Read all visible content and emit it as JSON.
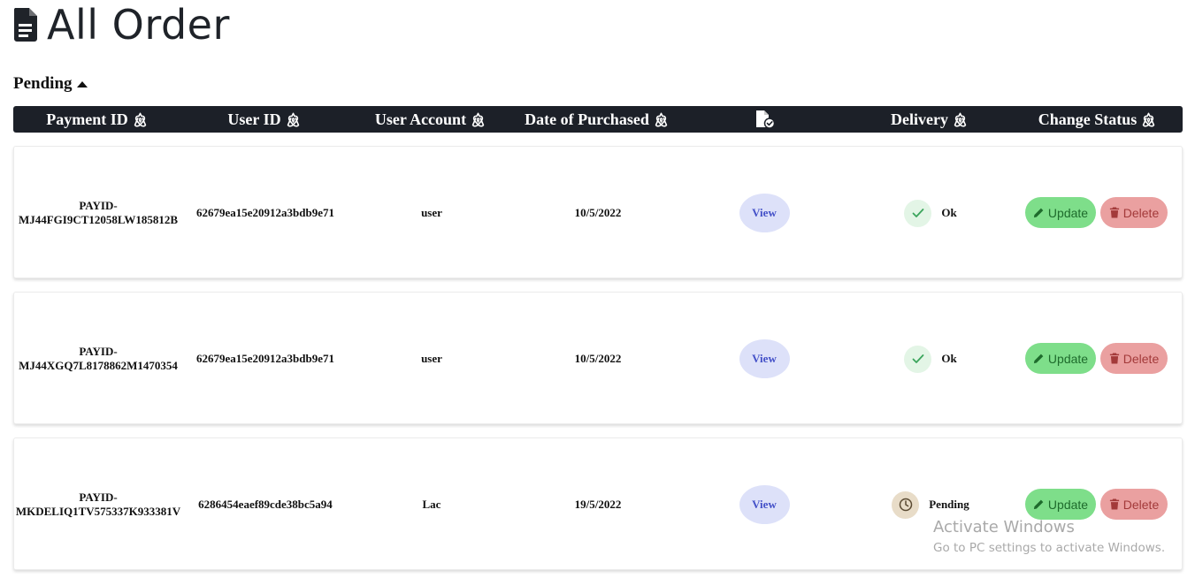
{
  "page": {
    "title": "All Order"
  },
  "section": {
    "label": "Pending"
  },
  "table": {
    "headers": {
      "payment_id": "Payment ID",
      "user_id": "User ID",
      "user_account": "User Account",
      "date": "Date of Purchased",
      "delivery": "Delivery",
      "change_status": "Change Status"
    }
  },
  "orders": [
    {
      "payment_line1": "PAYID-",
      "payment_line2": "MJ44FGI9CT12058LW185812B",
      "user_id": "62679ea15e20912a3bdb9e71",
      "account": "user",
      "date": "10/5/2022",
      "view_label": "View",
      "delivery": "Ok",
      "update_label": "Update",
      "delete_label": "Delete"
    },
    {
      "payment_line1": "PAYID-",
      "payment_line2": "MJ44XGQ7L8178862M1470354",
      "user_id": "62679ea15e20912a3bdb9e71",
      "account": "user",
      "date": "10/5/2022",
      "view_label": "View",
      "delivery": "Ok",
      "update_label": "Update",
      "delete_label": "Delete"
    },
    {
      "payment_line1": "PAYID-",
      "payment_line2": "MKDELIQ1TV575337K933381V",
      "user_id": "6286454eaef89cde38bc5a94",
      "account": "Lac",
      "date": "19/5/2022",
      "view_label": "View",
      "delivery": "Pending",
      "update_label": "Update",
      "delete_label": "Delete"
    }
  ],
  "watermark": {
    "title": "Activate Windows",
    "subtitle": "Go to PC settings to activate Windows."
  },
  "colors": {
    "header_bg": "#1c2028",
    "view_bg": "#dde1f9",
    "update_bg": "#7ede8a",
    "delete_bg": "#eaa0a0",
    "ok_bg": "#e3f5e6",
    "pending_bg": "#e8dcc8"
  },
  "icons": {
    "title": "file-document-icon",
    "section": "caret-up-icon",
    "header_sort": "airbnb-icon",
    "header_doc": "file-check-icon",
    "delivered": "check-icon",
    "pending": "clock-icon",
    "update": "pencil-icon",
    "delete": "trash-icon"
  }
}
